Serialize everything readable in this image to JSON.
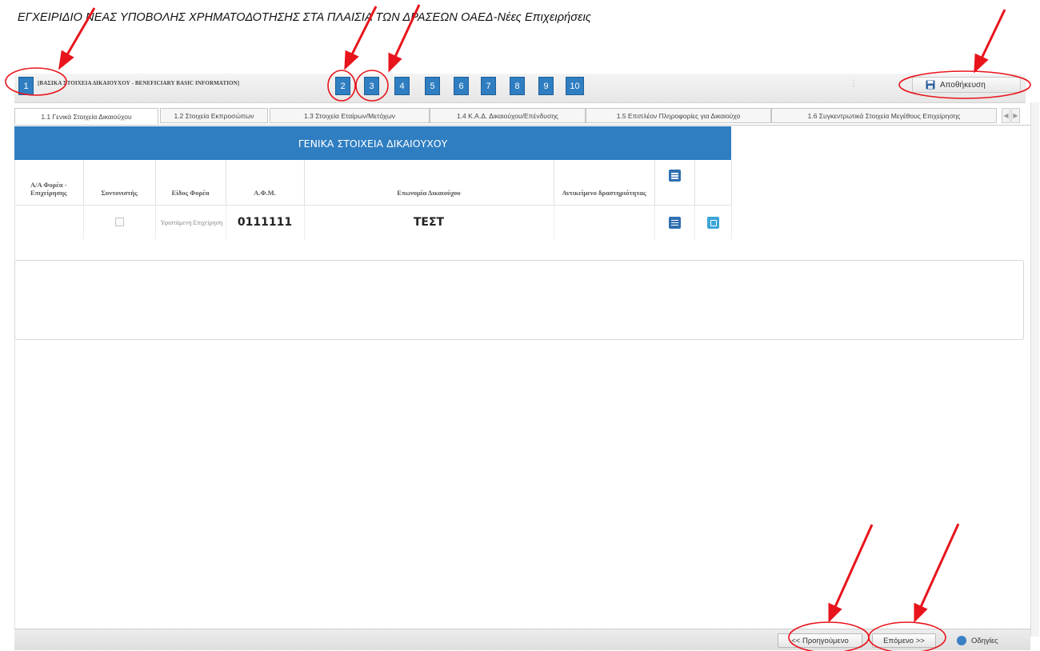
{
  "doc_title": "ΕΓΧΕΙΡΙΔΙΟ ΝΕΑΣ ΥΠΟΒΟΛΗΣ ΧΡΗΜΑΤΟΔΟΤΗΣΗΣ ΣΤΑ ΠΛΑΙΣΙΑ ΤΩΝ ΔΡΑΣΕΩΝ ΟΑΕΔ-Νέες Επιχειρήσεις",
  "stepbar": {
    "steps": [
      "1",
      "2",
      "3",
      "4",
      "5",
      "6",
      "7",
      "8",
      "9",
      "10"
    ],
    "current_step_title": "[ΒΑΣΙΚΑ ΣΤΟΙΧΕΙΑ ΔΙΚΑΙΟΥΧΟΥ - BENEFICIARY BASIC INFORMATION]",
    "save_label": "Αποθήκευση"
  },
  "tabs": [
    "1.1 Γενικά Στοιχεία Δικαιούχου",
    "1.2 Στοιχεία Εκπροσώπων",
    "1.3 Στοιχεία Εταίρων/Μετόχων",
    "1.4 Κ.Α.Δ. Δικαιούχου/Επένδυσης",
    "1.5 Επιπλέον Πληροφορίες για Δικαιούχο",
    "1.6 Συγκεντρωτικά Στοιχεία Μεγέθους Επιχείρησης"
  ],
  "grid": {
    "title": "ΓΕΝΙΚΑ ΣΤΟΙΧΕΙΑ ΔΙΚΑΙΟΥΧΟΥ",
    "columns": [
      "Α/Α Φορέα - Επιχείρησης",
      "Συντονιστής",
      "Είδος Φορέα",
      "Α.Φ.Μ.",
      "Επωνυμία Δικαιούχου",
      "Αντικείμενο δραστηριότητας"
    ],
    "row": {
      "aa": "",
      "coordinator_checked": false,
      "type": "Υφιστάμενη Επιχείρηση",
      "afm": "0111111",
      "name": "ΤΕΣΤ",
      "activity": ""
    }
  },
  "footer": {
    "prev_label": "<< Προηγούμενο",
    "next_label": "Επόμενο >>",
    "help_label": "Οδηγίες"
  },
  "colors": {
    "accent_blue": "#2f7ec1",
    "annotation_red": "#e8141c"
  }
}
